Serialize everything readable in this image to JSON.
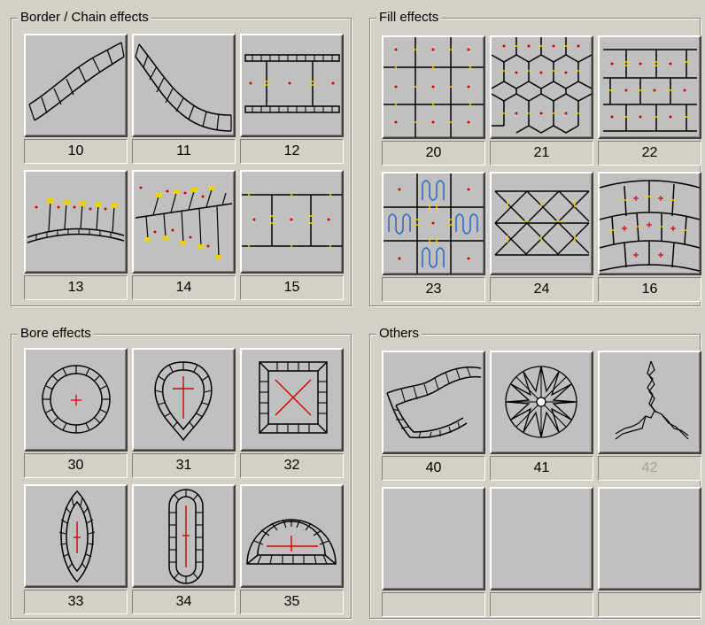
{
  "groups": {
    "border": {
      "title": "Border / Chain effects"
    },
    "fill": {
      "title": "Fill effects"
    },
    "bore": {
      "title": "Bore effects"
    },
    "others": {
      "title": "Others"
    }
  },
  "tiles": {
    "b1": "10",
    "b2": "11",
    "b3": "12",
    "b4": "13",
    "b5": "14",
    "b6": "15",
    "f1": "20",
    "f2": "21",
    "f3": "22",
    "f4": "23",
    "f5": "24",
    "f6": "16",
    "r1": "30",
    "r2": "31",
    "r3": "32",
    "r4": "33",
    "r5": "34",
    "r6": "35",
    "o1": "40",
    "o2": "41",
    "o3": "42",
    "o4": "",
    "o5": "",
    "o6": ""
  },
  "icons": {
    "b1": "diagonal-chain-icon",
    "b2": "curved-chain-icon",
    "b3": "rail-chain-icon",
    "b4": "arched-fringe-icon",
    "b5": "slanted-fringe-icon",
    "b6": "grid-panel-icon",
    "f1": "square-grid-icon",
    "f2": "hexagon-grid-icon",
    "f3": "brick-grid-icon",
    "f4": "wave-grid-icon",
    "f5": "diamond-lattice-icon",
    "f6": "arc-grid-icon",
    "r1": "round-bore-icon",
    "r2": "drop-bore-icon",
    "r3": "square-bore-icon",
    "r4": "eye-bore-icon",
    "r5": "oval-bore-icon",
    "r6": "half-circle-bore-icon",
    "o1": "ribbon-icon",
    "o2": "star-wheel-icon",
    "o3": "crack-icon"
  },
  "colors": {
    "window": "#d4d0c8",
    "button": "#c0c0c0",
    "accent_red": "#d40000",
    "accent_yellow": "#e8d020",
    "accent_blue": "#2266cc",
    "disabled_text": "#a0a0a0"
  }
}
